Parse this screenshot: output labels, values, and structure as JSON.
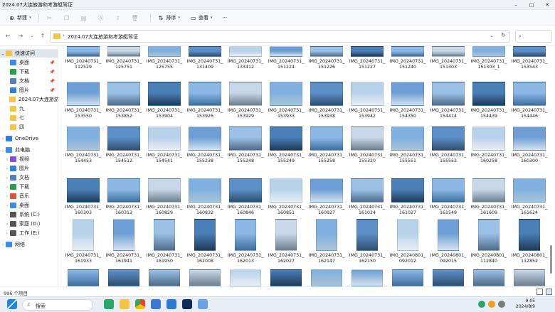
{
  "window": {
    "title": "2024.07大连旅游和考游艇驾证",
    "min": "–",
    "max": "□",
    "close": "✕"
  },
  "toolbar": {
    "new_label": "新建",
    "sort_label": "排序",
    "view_label": "查看",
    "more_label": "···"
  },
  "address": {
    "path": "2024.07大连旅游和考游艇驾证",
    "search_placeholder": ""
  },
  "sidebar": {
    "quick_access": "快速访问",
    "items": [
      {
        "label": "桌面",
        "color": "#3c8ce7",
        "pinned": true
      },
      {
        "label": "下载",
        "color": "#2d9c48",
        "pinned": true
      },
      {
        "label": "文档",
        "color": "#5a7fb8",
        "pinned": true
      },
      {
        "label": "图片",
        "color": "#2f7fd8",
        "pinned": true
      },
      {
        "label": "2024.07大连旅游和",
        "color": "#f4c542",
        "pinned": false
      },
      {
        "label": "九",
        "color": "#f4c542",
        "pinned": false
      },
      {
        "label": "七",
        "color": "#f4c542",
        "pinned": false
      },
      {
        "label": "四",
        "color": "#f4c542",
        "pinned": false
      }
    ],
    "onedrive": "OneDrive",
    "this_pc": "此电脑",
    "pc_items": [
      {
        "label": "视频",
        "color": "#8a4fd1"
      },
      {
        "label": "图片",
        "color": "#2f7fd8"
      },
      {
        "label": "文档",
        "color": "#5a7fb8"
      },
      {
        "label": "下载",
        "color": "#2d9c48"
      },
      {
        "label": "音乐",
        "color": "#e0503c"
      },
      {
        "label": "桌面",
        "color": "#3c8ce7"
      },
      {
        "label": "系统 (C:)",
        "color": "#555"
      },
      {
        "label": "家庭 (D:)",
        "color": "#555"
      },
      {
        "label": "工作 (E:)",
        "color": "#555"
      }
    ],
    "network": "网络"
  },
  "files": [
    [
      "IMG_20240731_112529",
      "IMG_20240731_125751",
      "IMG_20240731_125755",
      "IMG_20240731_131409",
      "IMG_20240731_133412",
      "IMG_20240731_151224",
      "IMG_20240731_151226",
      "IMG_20240731_151227",
      "IMG_20240731_151240",
      "IMG_20240731_151303",
      "IMG_20240731_151303_1",
      "IMG_20240731_153543"
    ],
    [
      "IMG_20240731_153550",
      "IMG_20240731_153852",
      "IMG_20240731_153904",
      "IMG_20240731_153926",
      "IMG_20240731_153929",
      "IMG_20240731_153933",
      "IMG_20240731_153938",
      "IMG_20240731_153942",
      "IMG_20240731_154350",
      "IMG_20240731_154414",
      "IMG_20240731_154439",
      "IMG_20240731_154446"
    ],
    [
      "IMG_20240731_154453",
      "IMG_20240731_154512",
      "IMG_20240731_154541",
      "IMG_20240731_155238",
      "IMG_20240731_155248",
      "IMG_20240731_155249",
      "IMG_20240731_155258",
      "IMG_20240731_155320",
      "IMG_20240731_155551",
      "IMG_20240731_155552",
      "IMG_20240731_160258",
      "IMG_20240731_160300"
    ],
    [
      "IMG_20240731_160303",
      "IMG_20240731_160313",
      "IMG_20240731_160829",
      "IMG_20240731_160832",
      "IMG_20240731_160846",
      "IMG_20240731_160851",
      "IMG_20240731_160927",
      "IMG_20240731_161024",
      "IMG_20240731_161027",
      "IMG_20240731_161549",
      "IMG_20240731_161609",
      "IMG_20240731_161624"
    ],
    [
      "IMG_20240731_161933",
      "IMG_20240731_161941",
      "IMG_20240731_161950",
      "IMG_20240731_162008",
      "IMG_20240731_162013",
      "IMG_20240731_162027",
      "IMG_20240731_162147",
      "IMG_20240731_162150",
      "IMG_20240801_092012",
      "IMG_20240801_092015",
      "IMG_20240801_112840",
      "IMG_20240801_112852"
    ]
  ],
  "status": {
    "count": "996 个项目"
  },
  "taskbar": {
    "search_label": "搜索",
    "time": "9:05",
    "date": "2024/8/9"
  }
}
